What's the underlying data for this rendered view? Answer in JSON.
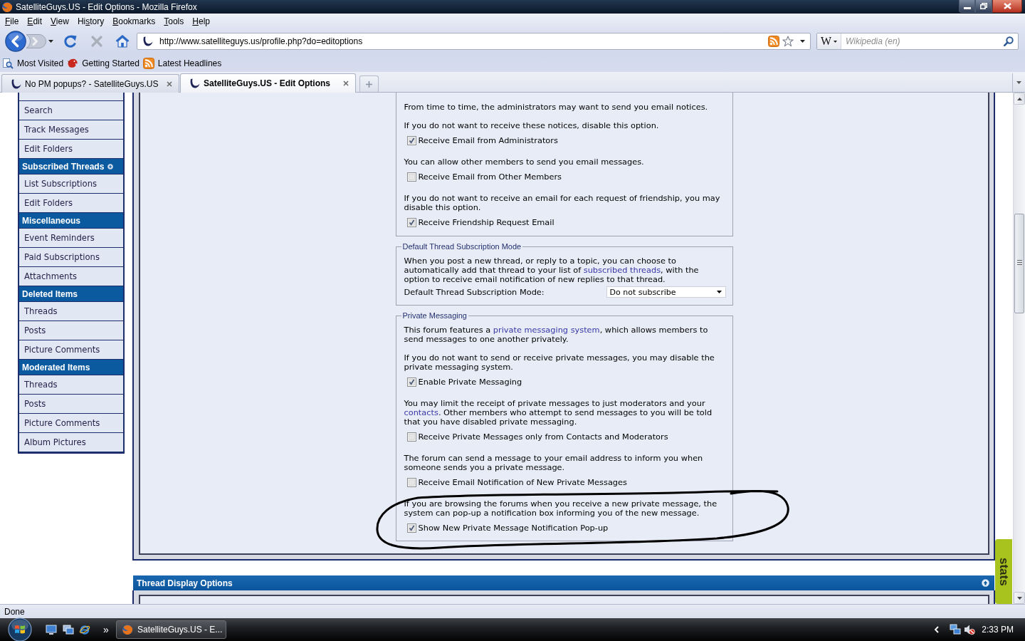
{
  "window": {
    "title": "SatelliteGuys.US - Edit Options - Mozilla Firefox"
  },
  "menu": [
    {
      "key": "F",
      "post": "ile"
    },
    {
      "key": "E",
      "post": "dit"
    },
    {
      "key": "V",
      "post": "iew"
    },
    {
      "pre": "Hi",
      "key": "s",
      "post": "tory"
    },
    {
      "key": "B",
      "post": "ookmarks"
    },
    {
      "key": "T",
      "post": "ools"
    },
    {
      "key": "H",
      "post": "elp"
    }
  ],
  "navigation": {
    "back_disabled": false,
    "forward_disabled": true,
    "stop_disabled": true,
    "address": "http://www.satelliteguys.us/profile.php?do=editoptions",
    "search_engine": "W",
    "search_placeholder": "Wikipedia (en)"
  },
  "bookmarks": [
    {
      "kind": "smart",
      "label": "Most Visited"
    },
    {
      "kind": "page",
      "label": "Getting Started"
    },
    {
      "kind": "feed",
      "label": "Latest Headlines"
    }
  ],
  "tabs": [
    {
      "label": "No PM popups? - SatelliteGuys.US",
      "selected": false
    },
    {
      "label": "SatelliteGuys.US - Edit Options",
      "selected": true
    }
  ],
  "sidebar": [
    {
      "items": [
        "Search",
        "Track Messages",
        "Edit Folders"
      ]
    },
    {
      "heading": "Subscribed Threads",
      "expandable": true,
      "items": [
        "List Subscriptions",
        "Edit Folders"
      ]
    },
    {
      "heading": "Miscellaneous",
      "expandable": false,
      "items": [
        "Event Reminders",
        "Paid Subscriptions",
        "Attachments"
      ]
    },
    {
      "heading": "Deleted Items",
      "expandable": false,
      "items": [
        "Threads",
        "Posts",
        "Picture Comments"
      ]
    },
    {
      "heading": "Moderated Items",
      "expandable": false,
      "items": [
        "Threads",
        "Posts",
        "Picture Comments",
        "Album Pictures"
      ]
    }
  ],
  "fieldsets": [
    {
      "options": [
        {
          "description": [
            {
              "text": "From time to time, the administrators may want to send you email notices."
            }
          ],
          "circled": false
        },
        {
          "description": [
            {
              "text": "If you do not want to receive these notices, disable this option."
            }
          ],
          "checkbox": {
            "label": "Receive Email from Administrators",
            "checked": true
          },
          "circled": false
        },
        {
          "description": [
            {
              "text": "You can allow other members to send you email messages."
            }
          ],
          "checkbox": {
            "label": "Receive Email from Other Members",
            "checked": false
          },
          "circled": false
        },
        {
          "description": [
            {
              "text": "If you do not want to receive an email for each request of friendship, you may disable this option."
            }
          ],
          "checkbox": {
            "label": "Receive Friendship Request Email",
            "checked": true
          },
          "circled": false
        }
      ]
    },
    {
      "legend": "Default Thread Subscription Mode",
      "options": [
        {
          "description": [
            {
              "text": "When you post a new thread, or reply to a topic, you can choose to automatically add that thread to your list of "
            },
            {
              "link": "subscribed threads"
            },
            {
              "text": ", with the option to receive email notification of new replies to that thread."
            }
          ],
          "select": {
            "label": "Default Thread Subscription Mode:",
            "value": "Do not subscribe"
          },
          "circled": false
        }
      ]
    },
    {
      "legend": "Private Messaging",
      "options": [
        {
          "description": [
            {
              "text": "This forum features a "
            },
            {
              "link": "private messaging system"
            },
            {
              "text": ", which allows members to send messages to one another privately."
            }
          ],
          "circled": false
        },
        {
          "description": [
            {
              "text": "If you do not want to send or receive private messages, you may disable the private messaging system."
            }
          ],
          "checkbox": {
            "label": "Enable Private Messaging",
            "checked": true
          },
          "circled": false
        },
        {
          "description": [
            {
              "text": "You may limit the receipt of private messages to just moderators and your "
            },
            {
              "link": "contacts"
            },
            {
              "text": ". Other members who attempt to send messages to you will be told that you have disabled private messaging."
            }
          ],
          "checkbox": {
            "label": "Receive Private Messages only from Contacts and Moderators",
            "checked": false
          },
          "circled": false
        },
        {
          "description": [
            {
              "text": "The forum can send a message to your email address to inform you when someone sends you a private message."
            }
          ],
          "checkbox": {
            "label": "Receive Email Notification of New Private Messages",
            "checked": false
          },
          "circled": false
        },
        {
          "description": [
            {
              "text": "If you are browsing the forums when you receive a new private message, the system can pop-up a notification box informing you of the new message."
            }
          ],
          "checkbox": {
            "label": "Show New Private Message Notification Pop-up",
            "checked": true
          },
          "circled": true
        }
      ]
    }
  ],
  "thread_display": {
    "title": "Thread Display Options"
  },
  "stats_tab": {
    "label": "stats"
  },
  "status_bar": {
    "text": "Done"
  },
  "taskbar": {
    "more": "»",
    "task": "SatelliteGuys.US - E...",
    "clock": "2:33 PM"
  }
}
